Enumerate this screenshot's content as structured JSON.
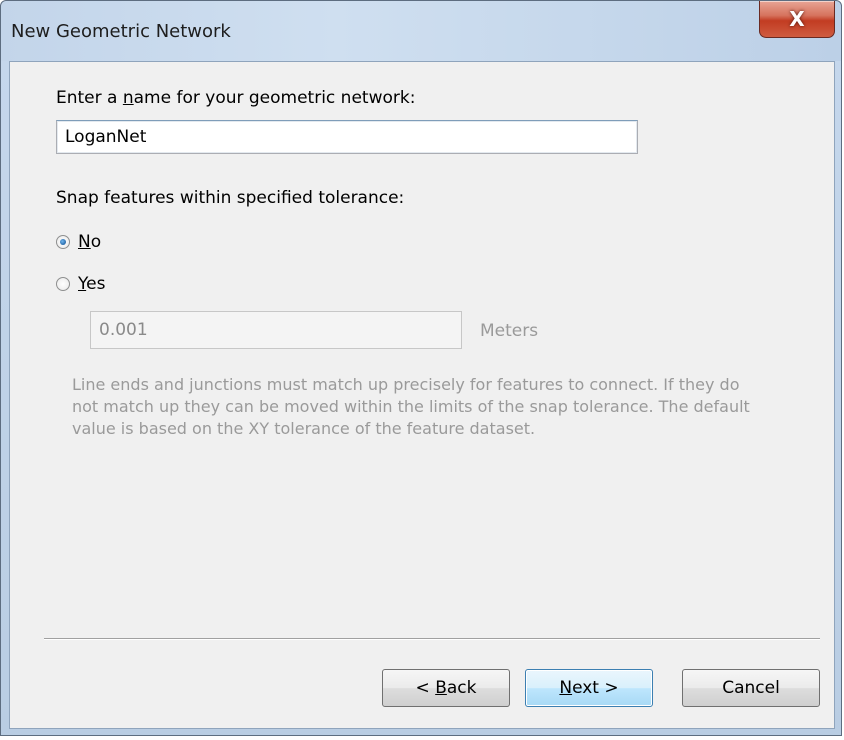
{
  "window": {
    "title": "New Geometric Network",
    "close_glyph": "X"
  },
  "name_section": {
    "label_prefix": "Enter a ",
    "label_mnemonic": "n",
    "label_suffix": "ame for your geometric network:",
    "value": "LoganNet"
  },
  "snap_section": {
    "label": "Snap features within specified tolerance:",
    "options": [
      {
        "mnemonic": "N",
        "rest": "o",
        "checked": true
      },
      {
        "mnemonic": "Y",
        "rest": "es",
        "checked": false
      }
    ],
    "tolerance_value": "0.001",
    "units": "Meters",
    "help_text": "Line ends and junctions must match up precisely for features to connect. If they do not match up they can be moved within the limits of the snap tolerance. The default value is based on the XY tolerance of the feature dataset."
  },
  "buttons": {
    "back_prefix": "< ",
    "back_mnemonic": "B",
    "back_rest": "ack",
    "next_mnemonic": "N",
    "next_rest": "ext >",
    "cancel": "Cancel"
  }
}
